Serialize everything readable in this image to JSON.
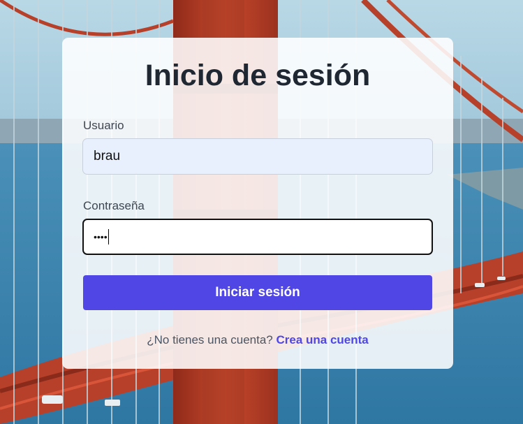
{
  "login": {
    "title": "Inicio de sesión",
    "username_label": "Usuario",
    "username_value": "brau",
    "password_label": "Contraseña",
    "password_masked": "••••",
    "submit_label": "Iniciar sesión",
    "signup_prompt": "¿No tienes una cuenta?",
    "signup_link": "Crea una cuenta"
  },
  "colors": {
    "accent": "#4f46e5",
    "title": "#1f2733",
    "username_field_bg": "#e8f0fe",
    "bridge_red": "#c0452c"
  }
}
